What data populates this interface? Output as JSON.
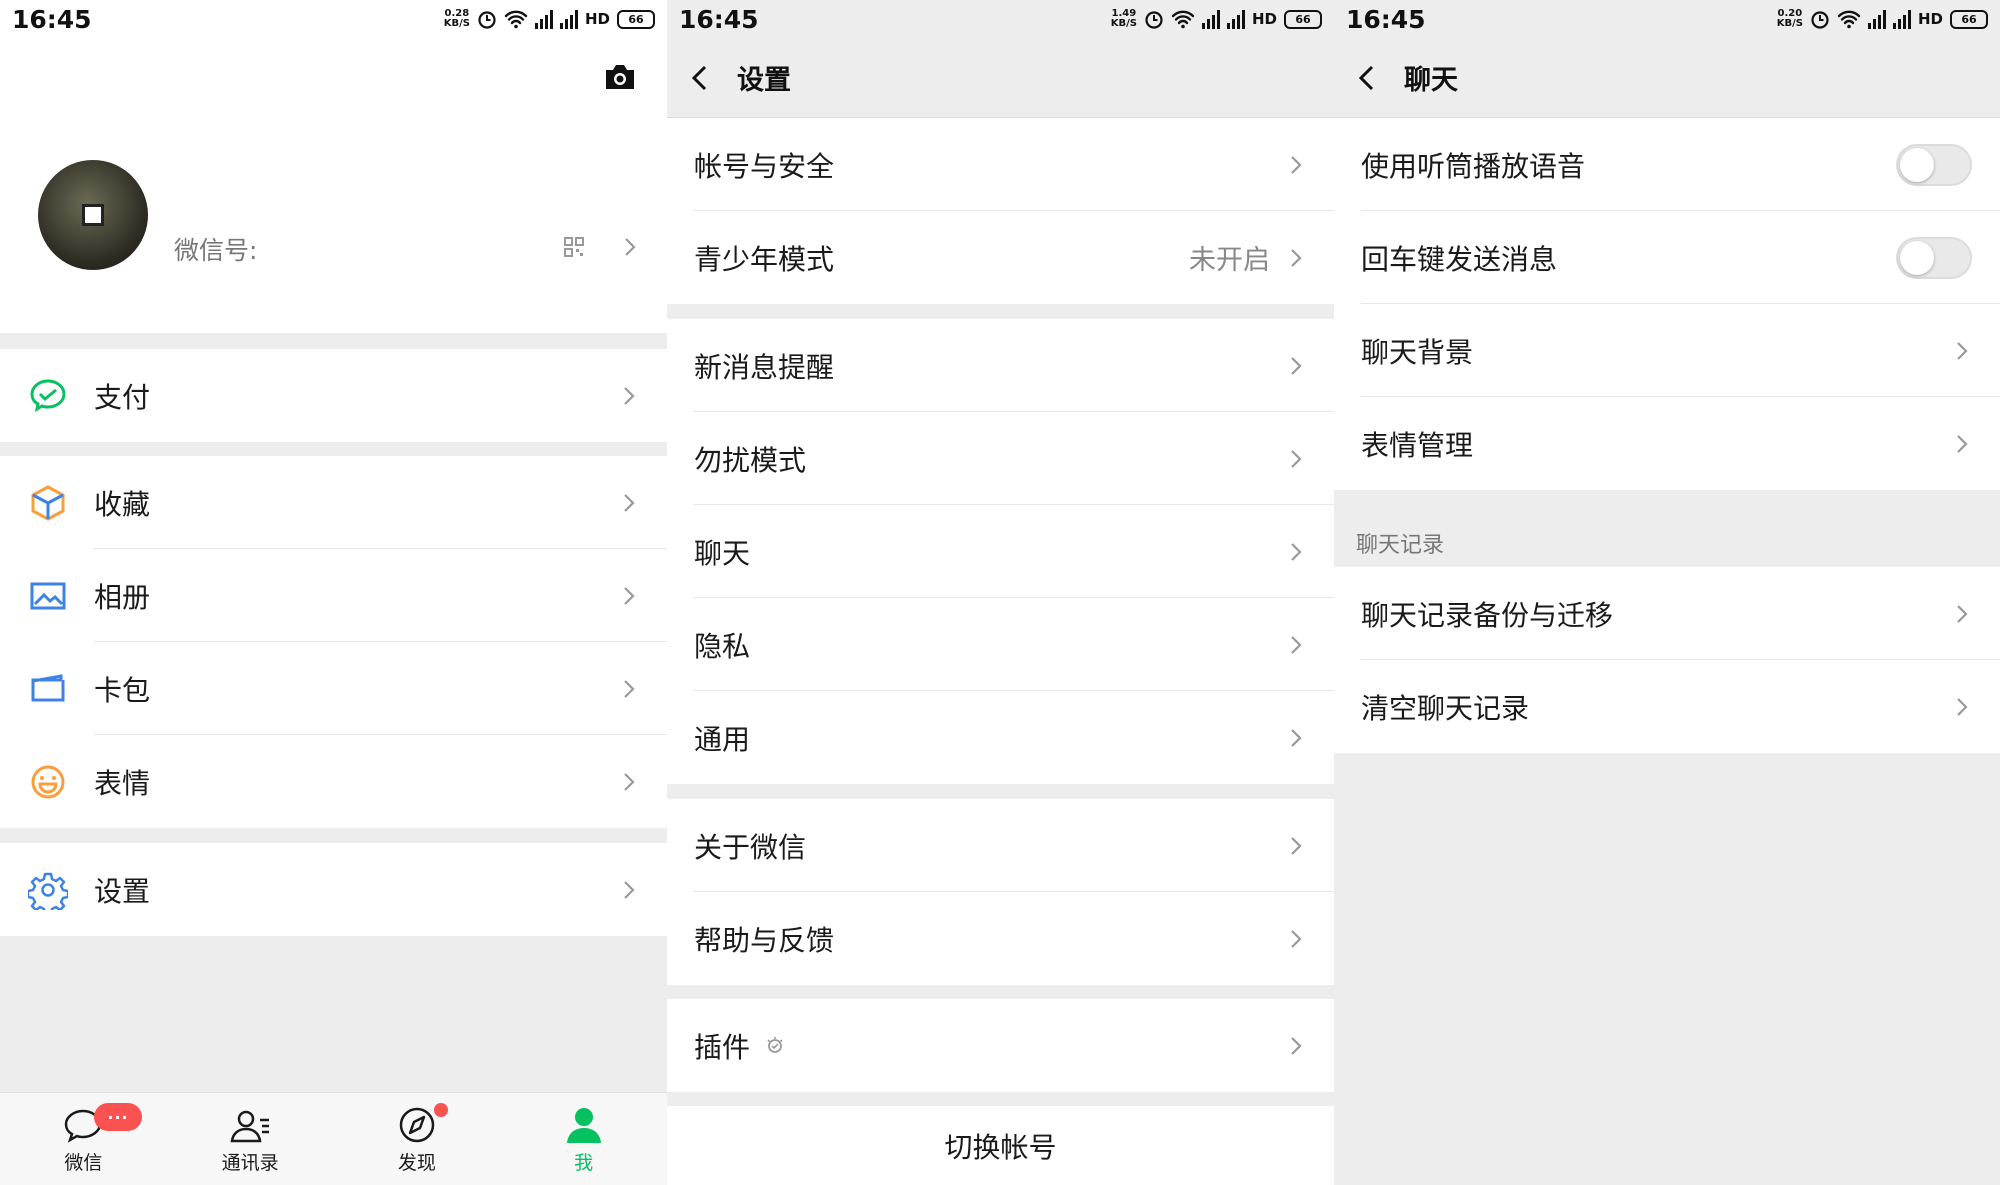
{
  "status_bars": [
    {
      "time": "16:45",
      "speed_top": "0.28",
      "speed_bottom": "KB/S",
      "battery": "66"
    },
    {
      "time": "16:45",
      "speed_top": "1.49",
      "speed_bottom": "KB/S",
      "battery": "66"
    },
    {
      "time": "16:45",
      "speed_top": "0.20",
      "speed_bottom": "KB/S",
      "battery": "66"
    }
  ],
  "me": {
    "wechat_id_label": "微信号:",
    "menu": [
      {
        "label": "支付",
        "icon": "pay-icon",
        "color": "#07c160"
      },
      {
        "label": "收藏",
        "icon": "favorites-icon",
        "color": "#fa9d3b"
      },
      {
        "label": "相册",
        "icon": "album-icon",
        "color": "#3d83e6"
      },
      {
        "label": "卡包",
        "icon": "card-wallet-icon",
        "color": "#3d83e6"
      },
      {
        "label": "表情",
        "icon": "sticker-icon",
        "color": "#fa9d3b"
      },
      {
        "label": "设置",
        "icon": "settings-gear-icon",
        "color": "#3d83e6"
      }
    ],
    "tabs": [
      {
        "label": "微信",
        "badge": "···"
      },
      {
        "label": "通讯录"
      },
      {
        "label": "发现"
      },
      {
        "label": "我"
      }
    ]
  },
  "settings": {
    "title": "设置",
    "items": [
      {
        "label": "帐号与安全"
      },
      {
        "label": "青少年模式",
        "value": "未开启"
      },
      {
        "label": "新消息提醒"
      },
      {
        "label": "勿扰模式"
      },
      {
        "label": "聊天"
      },
      {
        "label": "隐私"
      },
      {
        "label": "通用"
      },
      {
        "label": "关于微信"
      },
      {
        "label": "帮助与反馈"
      },
      {
        "label": "插件"
      }
    ],
    "switch_account": "切换帐号"
  },
  "chat": {
    "title": "聊天",
    "toggles": [
      {
        "label": "使用听筒播放语音",
        "on": false
      },
      {
        "label": "回车键发送消息",
        "on": false
      }
    ],
    "items": [
      {
        "label": "聊天背景"
      },
      {
        "label": "表情管理"
      }
    ],
    "history_section": "聊天记录",
    "history_items": [
      {
        "label": "聊天记录备份与迁移"
      },
      {
        "label": "清空聊天记录"
      }
    ]
  },
  "colors": {
    "accent": "#07c160",
    "badge": "#fa5151",
    "background": "#ededed"
  }
}
